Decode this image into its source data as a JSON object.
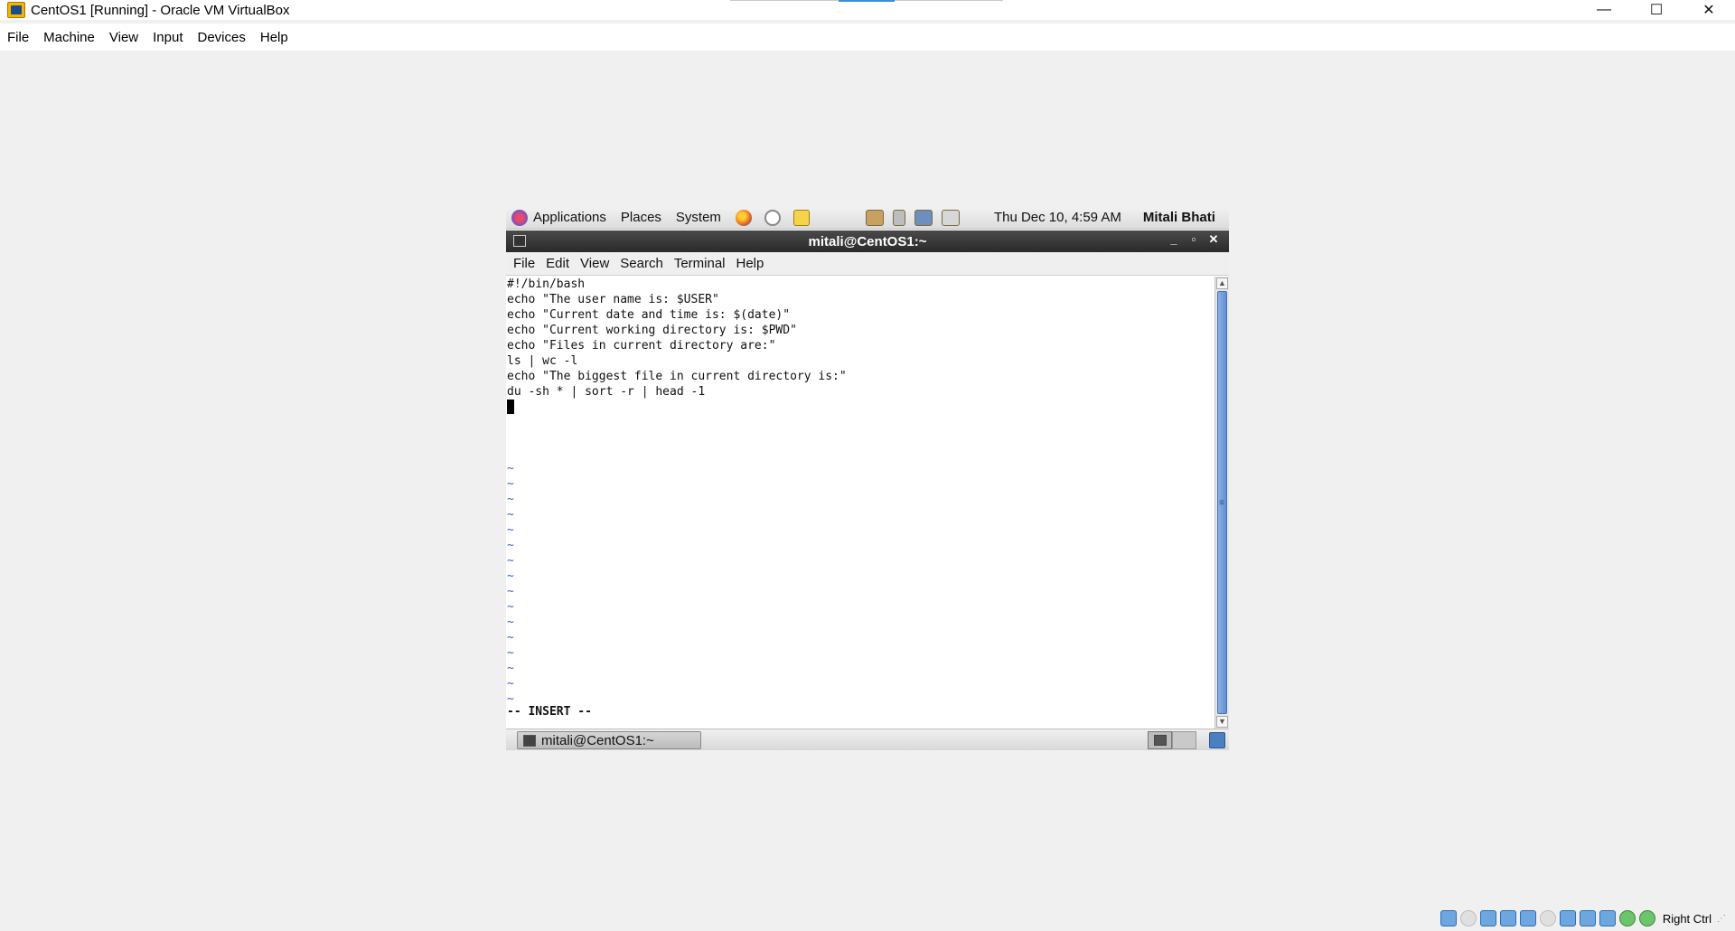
{
  "host": {
    "title": "CentOS1 [Running] - Oracle VM VirtualBox",
    "menu": [
      "File",
      "Machine",
      "View",
      "Input",
      "Devices",
      "Help"
    ],
    "controls": {
      "minimize": "—",
      "maximize": "☐",
      "close": "✕"
    },
    "status": {
      "host_key": "Right Ctrl"
    }
  },
  "gnome_panel": {
    "applications": "Applications",
    "places": "Places",
    "system": "System",
    "clock": "Thu Dec 10,  4:59 AM",
    "user": "Mitali Bhati"
  },
  "terminal": {
    "title": "mitali@CentOS1:~",
    "controls": {
      "minimize": "_",
      "maximize": "▫",
      "close": "✕"
    },
    "menu": [
      "File",
      "Edit",
      "View",
      "Search",
      "Terminal",
      "Help"
    ],
    "lines": [
      "#!/bin/bash",
      "echo \"The user name is: $USER\"",
      "echo \"Current date and time is: $(date)\"",
      "echo \"Current working directory is: $PWD\"",
      "echo \"Files in current directory are:\"",
      "ls | wc -l",
      "echo \"The biggest file in current directory is:\"",
      "du -sh * | sort -r | head -1"
    ],
    "tilde": "~",
    "mode": "-- INSERT --"
  },
  "taskbar": {
    "task_label": "mitali@CentOS1:~"
  }
}
